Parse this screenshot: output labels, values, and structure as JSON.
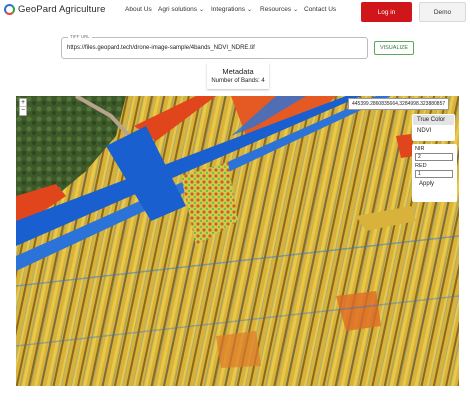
{
  "header": {
    "brand": "GeoPard Agriculture",
    "nav": [
      {
        "label": "About Us",
        "dropdown": false
      },
      {
        "label": "Agri solutions",
        "dropdown": true
      },
      {
        "label": "Integrations",
        "dropdown": true
      },
      {
        "label": "Resources",
        "dropdown": true
      },
      {
        "label": "Contact Us",
        "dropdown": false
      }
    ],
    "login_label": "Log in",
    "demo_label": "Demo"
  },
  "tiff": {
    "label": "TIFF URL",
    "value": "https://files.geopard.tech/drone-image-sample/4bands_NDVI_NDRE.tif",
    "visualize_label": "VISUALIZE"
  },
  "metadata": {
    "title": "Metadata",
    "bands_text": "Number of Bands: 4"
  },
  "map": {
    "zoom_in": "+",
    "zoom_out": "−",
    "coordinates": "445399.2860835664,3284998.323880857",
    "layers": [
      {
        "label": "True Color",
        "active": true
      },
      {
        "label": "NDVI",
        "active": false
      }
    ],
    "bands": {
      "nir_label": "NIR",
      "nir_value": "2",
      "red_label": "RED",
      "red_value": "1",
      "apply_label": "Apply"
    }
  },
  "colors": {
    "login_bg": "#d0161b",
    "visualize_border": "#5aa95a",
    "ndvi_low": "#1a5fd0",
    "ndvi_mid": "#e7c53a",
    "ndvi_high": "#e0451c"
  }
}
